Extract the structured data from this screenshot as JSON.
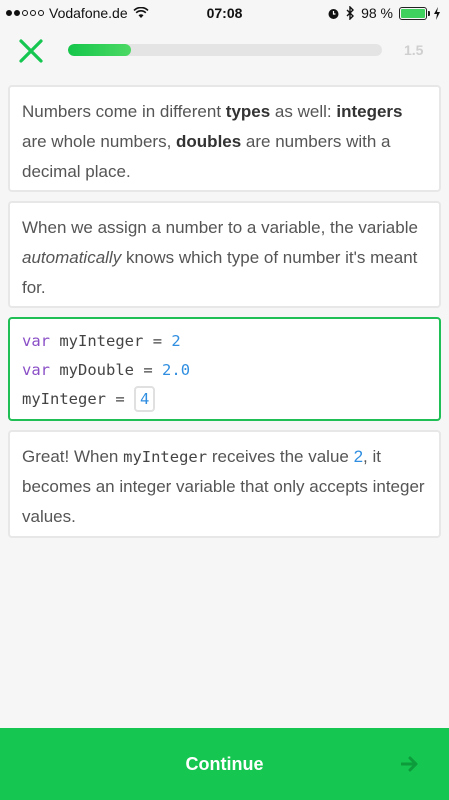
{
  "status_bar": {
    "carrier": "Vodafone.de",
    "time": "07:08",
    "battery_percent": "98 %",
    "battery_level": 0.98,
    "signal_bars_filled": 2,
    "signal_bars_total": 5
  },
  "header": {
    "progress": 0.2,
    "lesson_number": "1.5"
  },
  "cards": {
    "intro": {
      "t1": "Numbers come in different ",
      "b1": "types",
      "t2": " as well: ",
      "b2": "integers",
      "t3": " are whole numbers, ",
      "b3": "doubles",
      "t4": " are numbers with a decimal place."
    },
    "assign": {
      "t1": "When we assign a number to a variable, the variable ",
      "i1": "automatically",
      "t2": " knows which type of number it's meant for."
    },
    "code": {
      "line1_kw": "var",
      "line1_name": "myInteger",
      "line1_eq": "=",
      "line1_val": "2",
      "line2_kw": "var",
      "line2_name": "myDouble",
      "line2_eq": "=",
      "line2_val": "2.0",
      "line3_name": "myInteger",
      "line3_eq": "=",
      "line3_answer": "4"
    },
    "feedback": {
      "t1": "Great! When ",
      "code1": "myInteger",
      "t2": " receives the value ",
      "val": "2",
      "t3": ", it becomes an integer variable that only accepts integer values."
    }
  },
  "footer": {
    "continue_label": "Continue"
  },
  "colors": {
    "accent_green": "#15c650",
    "keyword_purple": "#8a4fc7",
    "number_blue": "#2f8ee0"
  },
  "icons": {
    "close": "close-icon",
    "wifi": "wifi-icon",
    "alarm": "alarm-icon",
    "bluetooth": "bluetooth-icon",
    "charging": "charging-icon",
    "arrow": "arrow-right-icon"
  }
}
